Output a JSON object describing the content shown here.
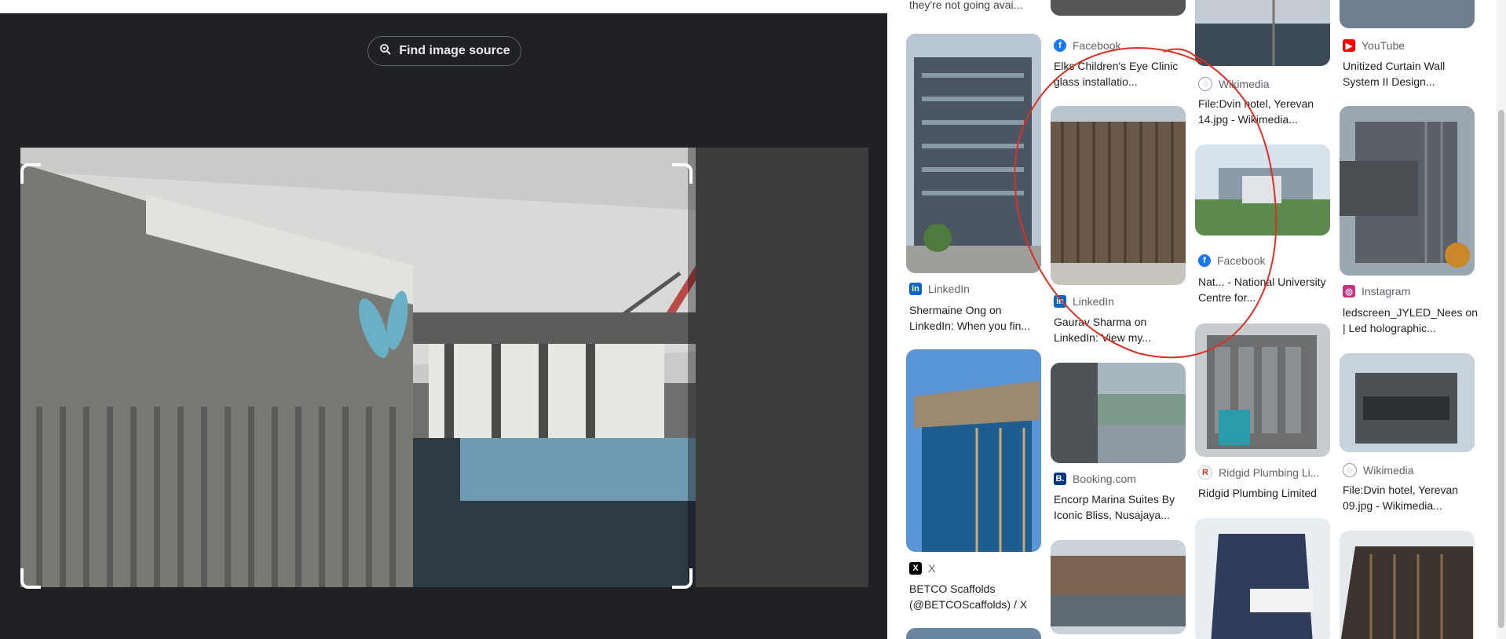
{
  "left_panel": {
    "find_button_label": "Find image source",
    "find_button_icon": "lens-search-icon"
  },
  "results": {
    "top_cut_text": "they're not going avai...",
    "col1": [
      {
        "source_icon": "linkedin-icon",
        "source": "LinkedIn",
        "title": "Shermaine Ong on LinkedIn: When you fin..."
      },
      {
        "source_icon": "x-icon",
        "source": "X",
        "title": "BETCO Scaffolds (@BETCOScaffolds) / X"
      }
    ],
    "col2": [
      {
        "source_icon": "facebook-icon",
        "source": "Facebook",
        "title": "Elks Children's Eye Clinic glass installatio..."
      },
      {
        "source_icon": "linkedin-icon",
        "source": "LinkedIn",
        "title": "Gaurav Sharma on LinkedIn: View my..."
      },
      {
        "source_icon": "booking-icon",
        "source": "Booking.com",
        "title": "Encorp Marina Suites By Iconic Bliss, Nusajaya..."
      }
    ],
    "col3": [
      {
        "source_icon": "wikimedia-icon",
        "source": "Wikimedia",
        "title": "File:Dvin hotel, Yerevan 14.jpg - Wikimedia..."
      },
      {
        "source_icon": "facebook-icon",
        "source": "Facebook",
        "title": "Nat... - National University Centre for..."
      },
      {
        "source_icon": "ridgid-icon",
        "source": "Ridgid Plumbing Li...",
        "title": "Ridgid Plumbing Limited"
      }
    ],
    "col4": [
      {
        "source_icon": "youtube-icon",
        "source": "YouTube",
        "title": "Unitized Curtain Wall System II Design..."
      },
      {
        "source_icon": "instagram-icon",
        "source": "Instagram",
        "title": "ledscreen_JYLED_Nees on | Led holographic..."
      },
      {
        "source_icon": "wikimedia-icon",
        "source": "Wikimedia",
        "title": "File:Dvin hotel, Yerevan 09.jpg - Wikimedia..."
      }
    ]
  },
  "colors": {
    "dark_bg": "#202124",
    "annotation_red": "#d93025",
    "facebook": "#1877f2",
    "linkedin": "#0a66c2",
    "youtube": "#ff0000",
    "booking": "#003580"
  }
}
